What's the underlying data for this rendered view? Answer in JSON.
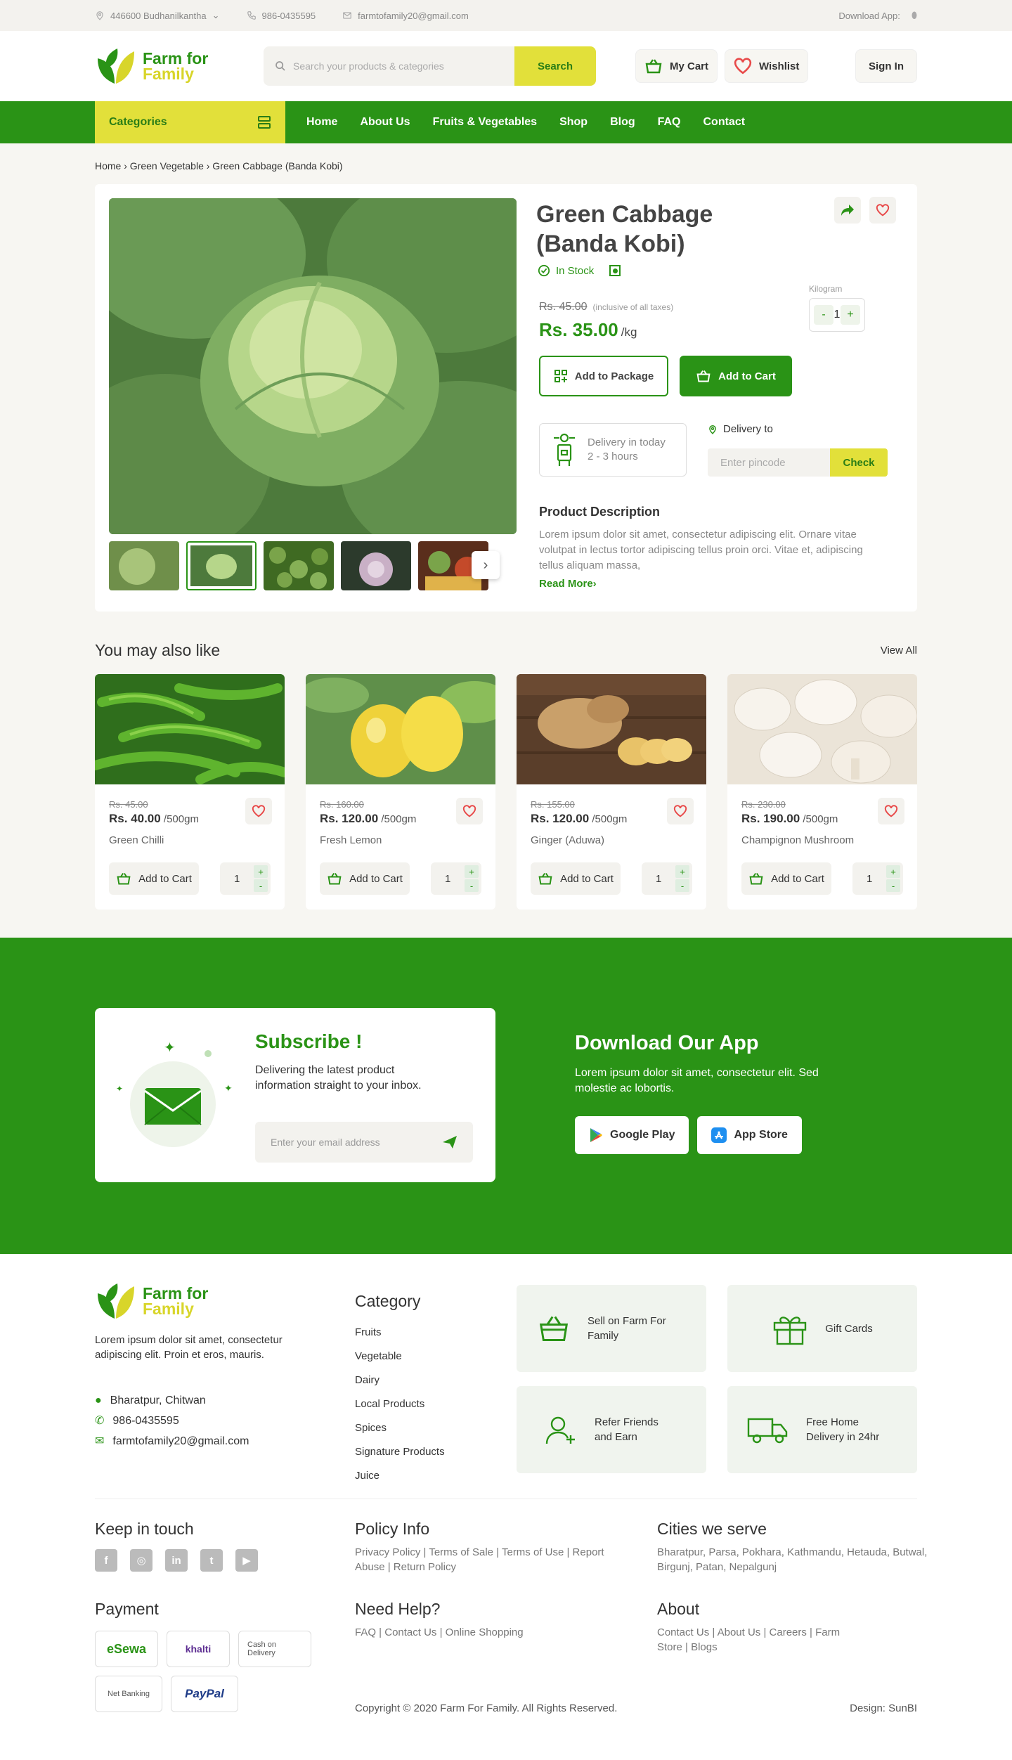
{
  "topbar": {
    "location": "446600 Budhanilkantha",
    "phone": "986-0435595",
    "email": "farmtofamily20@gmail.com",
    "download": "Download App:"
  },
  "header": {
    "logo_line1": "Farm for",
    "logo_line2": "Family",
    "search_placeholder": "Search your products & categories",
    "search_button": "Search",
    "cart": "My Cart",
    "wishlist": "Wishlist",
    "signin": "Sign In"
  },
  "nav": {
    "categories": "Categories",
    "links": [
      "Home",
      "About Us",
      "Fruits & Vegetables",
      "Shop",
      "Blog",
      "FAQ",
      "Contact"
    ]
  },
  "breadcrumb": "Home › Green Vegetable › Green Cabbage (Banda Kobi)",
  "product": {
    "title": "Green Cabbage (Banda Kobi)",
    "stock": "In Stock",
    "old_price": "Rs. 45.00",
    "tax_note": "(inclusive of all taxes)",
    "price": "Rs. 35.00",
    "unit": "/kg",
    "qty_label": "Kilogram",
    "qty": "1",
    "add_package": "Add to Package",
    "add_cart": "Add to Cart",
    "delivery_line1": "Delivery in today",
    "delivery_line2": "2 - 3 hours",
    "delivery_to": "Delivery to",
    "pincode_placeholder": "Enter pincode",
    "check": "Check",
    "desc_title": "Product Description",
    "desc": "Lorem ipsum dolor sit amet, consectetur adipiscing elit. Ornare vitae volutpat in lectus tortor adipiscing tellus proin orci. Vitae et, adipiscing tellus aliquam massa,",
    "read_more": "Read More›"
  },
  "related": {
    "title": "You may also like",
    "view_all": "View All",
    "items": [
      {
        "old": "Rs. 45.00",
        "price": "Rs. 40.00",
        "unit": " /500gm",
        "name": "Green Chilli",
        "add": "Add to Cart",
        "qty": "1"
      },
      {
        "old": "Rs. 160.00",
        "price": "Rs. 120.00",
        "unit": " /500gm",
        "name": "Fresh Lemon",
        "add": "Add to Cart",
        "qty": "1"
      },
      {
        "old": "Rs. 155.00",
        "price": "Rs. 120.00",
        "unit": " /500gm",
        "name": "Ginger (Aduwa)",
        "add": "Add to Cart",
        "qty": "1"
      },
      {
        "old": "Rs. 230.00",
        "price": "Rs. 190.00",
        "unit": " /500gm",
        "name": "Champignon Mushroom",
        "add": "Add to Cart",
        "qty": "1"
      }
    ]
  },
  "subscribe": {
    "title": "Subscribe !",
    "text": "Delivering the latest product information straight to your inbox.",
    "placeholder": "Enter your email address"
  },
  "app": {
    "title": "Download Our App",
    "text": "Lorem ipsum dolor sit amet, consectetur elit. Sed molestie ac lobortis.",
    "google": "Google Play",
    "apple": "App Store"
  },
  "footer": {
    "about": "Lorem ipsum dolor sit amet, consectetur adipiscing elit. Proin et eros, mauris.",
    "address": "Bharatpur, Chitwan",
    "phone": "986-0435595",
    "email": "farmtofamily20@gmail.com",
    "category_title": "Category",
    "categories": [
      "Fruits",
      "Vegetable",
      "Dairy",
      "Local Products",
      "Spices",
      "Signature Products",
      "Juice"
    ],
    "tiles": [
      "Sell on Farm For Family",
      "Gift Cards",
      "Refer Friends and Earn",
      "Free Home Delivery in 24hr"
    ],
    "keep": "Keep in touch",
    "policy_title": "Policy Info",
    "policy": "Privacy Policy | Terms of Sale | Terms of Use | Report Abuse | Return Policy",
    "cities_title": "Cities we serve",
    "cities": "Bharatpur, Parsa, Pokhara, Kathmandu, Hetauda, Butwal, Birgunj, Patan, Nepalgunj",
    "payment": "Payment",
    "pay_methods": [
      "eSewa",
      "khalti",
      "Cash on Delivery",
      "Net Banking",
      "PayPal"
    ],
    "help_title": "Need Help?",
    "help": "FAQ | Contact Us | Online Shopping",
    "about_title": "About",
    "about_links": "Contact Us | About Us | Careers | Farm Store | Blogs",
    "copyright": "Copyright © 2020 Farm For Family. All Rights Reserved.",
    "design": "Design: SunBI"
  }
}
